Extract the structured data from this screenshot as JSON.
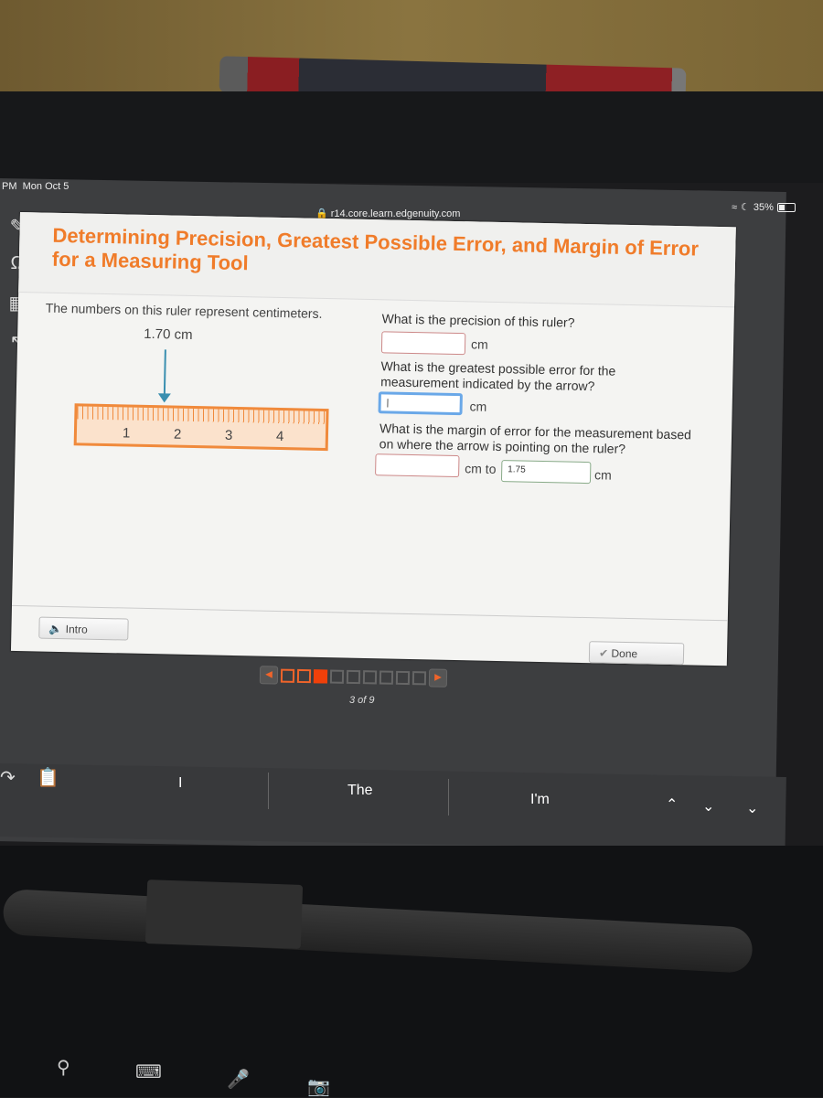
{
  "status_bar": {
    "time": "PM",
    "date": "Mon Oct 5",
    "battery": "35%"
  },
  "browser": {
    "url": "r14.core.learn.edgenuity.com"
  },
  "lesson": {
    "title": "Determining Precision, Greatest Possible Error, and Margin of Error for a Measuring Tool",
    "intro_text": "The numbers on this ruler represent centimeters.",
    "measurement_label": "1.70 cm",
    "ruler_numbers": [
      "1",
      "2",
      "3",
      "4"
    ],
    "questions": [
      {
        "text": "What is the precision of this ruler?",
        "value": "",
        "unit": "cm"
      },
      {
        "text": "What is the greatest possible error for the measurement indicated by the arrow?",
        "value": "",
        "unit": "cm"
      },
      {
        "text": "What is the margin of error for the measurement based on where the arrow is pointing on the ruler?",
        "value_from": "",
        "unit_mid": "cm to",
        "value_to": "1.75",
        "unit": "cm"
      }
    ],
    "intro_button": "Intro",
    "done_button": "Done"
  },
  "pager": {
    "current": 3,
    "total": 9,
    "label": "3 of 9"
  },
  "keyboard": {
    "suggestions": [
      "I",
      "The",
      "I'm"
    ]
  },
  "colors": {
    "accent": "#f07c2a",
    "current_page": "#f0400a",
    "arrow": "#3a8fb0"
  }
}
